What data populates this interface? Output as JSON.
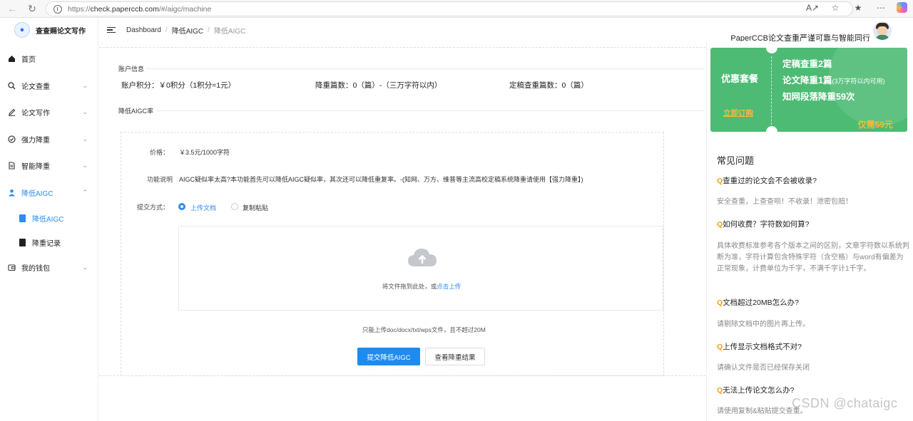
{
  "browser": {
    "url_prefix": "https://",
    "url_host": "check.paperccb.com",
    "url_path": "/#/aigc/machine"
  },
  "sidebar": {
    "logo_text": "查查赐论文写作",
    "items": [
      {
        "label": "首页",
        "icon": "home-icon"
      },
      {
        "label": "论文查重",
        "icon": "search-icon"
      },
      {
        "label": "论文写作",
        "icon": "pen-icon"
      },
      {
        "label": "强力降重",
        "icon": "check-circle-icon"
      },
      {
        "label": "智能降重",
        "icon": "document-icon"
      },
      {
        "label": "降低AIGC",
        "icon": "user-icon"
      },
      {
        "label": "我的钱包",
        "icon": "wallet-icon"
      }
    ],
    "sub_items": [
      {
        "label": "降低AIGC"
      },
      {
        "label": "降重记录"
      }
    ]
  },
  "header": {
    "breadcrumbs": [
      "Dashboard",
      "降低AIGC",
      "降低AIGC"
    ],
    "slogan": "PaperCCB论文查重严谨可靠与智能同行"
  },
  "account": {
    "section_title": "账户信息",
    "points": "账户积分：￥0积分（1积分=1元）",
    "reduce_count": "降重篇数：0（篇）-（三万字符以内）",
    "final_check_count": "定稿查重篇数：0（篇）"
  },
  "aigc": {
    "section_title": "降低AIGC率",
    "price_label": "价格：",
    "price_value": "￥3.5元/1000字符",
    "desc_label": "功能说明",
    "desc_value": "AIGC疑似率太高?本功能首先可以降低AIGC疑似率，其次还可以降低重复率。-(知网、万方、维普等主流高校定稿系统降重请使用【强力降重】)",
    "submit_method_label": "提交方式：",
    "option_upload": "上传文档",
    "option_paste": "复制粘贴",
    "drop_text": "将文件拖到此处，或",
    "drop_link": "点击上传",
    "file_hint": "只能上传doc/docx/txt/wps文件，且不超过20M",
    "submit_button": "提交降低AIGC",
    "view_button": "查看降重结果"
  },
  "promo": {
    "left_title": "优惠套餐",
    "order_link": "立即订购",
    "line1": "定稿查重2篇",
    "line2_main": "论文降重1篇",
    "line2_note": "(3万字符以内可用)",
    "line3": "知网段落降重59次",
    "price": "仅需59元",
    "colors": {
      "bg": "#4dbb74",
      "accent": "#f6b93b"
    }
  },
  "faq": {
    "title": "常见问题",
    "items": [
      {
        "q": "查重过的论文会不会被收录?",
        "a": "安全查重，上查查呗！不收录！泄密包赔！"
      },
      {
        "q": "如何收费？字符数如何算?",
        "a": "具体收费标准参考各个版本之间的区别，文章字符数以系统判断为准，字符计算包含特殊字符（含空格）与word有偏差为正常现象，计费单位为千字，不满千字计1千字。"
      },
      {
        "q": "文档超过20MB怎么办?",
        "a": "请剔除文档中的图片再上传。"
      },
      {
        "q": "上传显示文档格式不对?",
        "a": "请确认文件是否已经保存关闭"
      },
      {
        "q": "无法上传论文怎么办?",
        "a": "请使用复制&粘贴提交查重。"
      }
    ],
    "q_mark": "Q"
  },
  "watermark": "CSDN @chataigc",
  "accent_color": "#2d8cf0"
}
